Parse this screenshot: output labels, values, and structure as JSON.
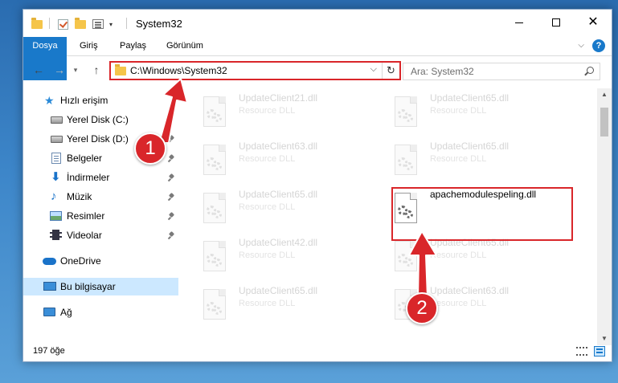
{
  "window": {
    "title": "System32",
    "min_label": "—",
    "close_label": "✕"
  },
  "ribbon": {
    "tabs": [
      "Dosya",
      "Giriş",
      "Paylaş",
      "Görünüm"
    ],
    "help": "?"
  },
  "navigation": {
    "back": "←",
    "forward": "→",
    "recent": "▾",
    "up": "↑",
    "address_path": "C:\\Windows\\System32",
    "dropdown": "⌵",
    "refresh": "↻",
    "search_placeholder": "Ara: System32"
  },
  "sidebar": {
    "items": [
      {
        "label": "Hızlı erişim",
        "icon": "star-icon",
        "pinned": false
      },
      {
        "label": "Yerel Disk (C:)",
        "icon": "drive-icon",
        "pinned": true
      },
      {
        "label": "Yerel Disk (D:)",
        "icon": "drive-icon",
        "pinned": true
      },
      {
        "label": "Belgeler",
        "icon": "documents-icon",
        "pinned": true
      },
      {
        "label": "İndirmeler",
        "icon": "download-icon",
        "pinned": true
      },
      {
        "label": "Müzik",
        "icon": "music-icon",
        "pinned": true
      },
      {
        "label": "Resimler",
        "icon": "pictures-icon",
        "pinned": true
      },
      {
        "label": "Videolar",
        "icon": "videos-icon",
        "pinned": true
      },
      {
        "label": "OneDrive",
        "icon": "onedrive-icon",
        "pinned": false
      },
      {
        "label": "Bu bilgisayar",
        "icon": "computer-icon",
        "pinned": false,
        "selected": true
      },
      {
        "label": "Ağ",
        "icon": "network-icon",
        "pinned": false
      }
    ]
  },
  "files": [
    {
      "name": "UpdateClient21.dll",
      "type": "Resource DLL"
    },
    {
      "name": "UpdateClient65.dll",
      "type": "Resource DLL"
    },
    {
      "name": "UpdateClient63.dll",
      "type": "Resource DLL"
    },
    {
      "name": "UpdateClient65.dll",
      "type": "Resource DLL"
    },
    {
      "name": "UpdateClient65.dll",
      "type": "Resource DLL"
    },
    {
      "name": "apachemodulespeling.dll",
      "type": ""
    },
    {
      "name": "UpdateClient42.dll",
      "type": "Resource DLL"
    },
    {
      "name": "UpdateClient65.dll",
      "type": "Resource DLL"
    },
    {
      "name": "UpdateClient65.dll",
      "type": "Resource DLL"
    },
    {
      "name": "UpdateClient63.dll",
      "type": "Resource DLL"
    }
  ],
  "status": {
    "item_count": "197 öğe"
  },
  "annotations": {
    "step1": "1",
    "step2": "2",
    "color": "#d9262a"
  }
}
